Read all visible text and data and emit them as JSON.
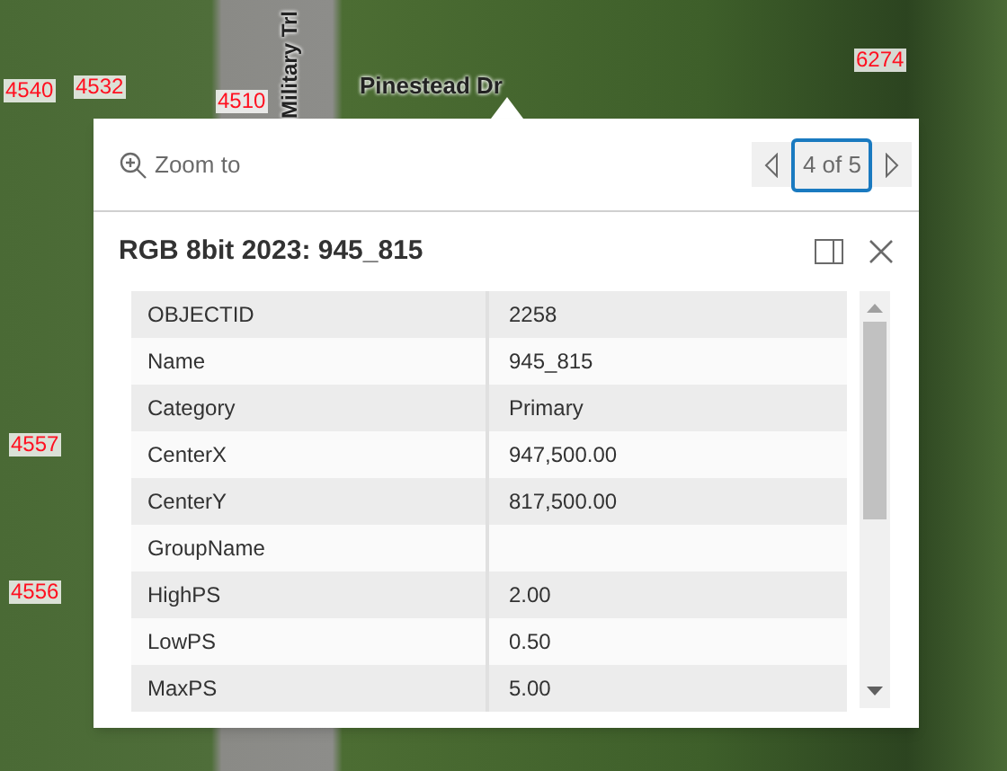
{
  "map_labels": [
    {
      "text": "4540",
      "kind": "parcel"
    },
    {
      "text": "4532",
      "kind": "parcel"
    },
    {
      "text": "4510",
      "kind": "parcel"
    },
    {
      "text": "Military Trl",
      "kind": "road-vertical"
    },
    {
      "text": "Pinestead Dr",
      "kind": "road"
    },
    {
      "text": "6274",
      "kind": "parcel"
    },
    {
      "text": "4557",
      "kind": "parcel"
    },
    {
      "text": "4556",
      "kind": "parcel"
    }
  ],
  "popup": {
    "zoom_to": "Zoom to",
    "pager": "4 of 5",
    "title": "RGB 8bit 2023: 945_815",
    "rows": [
      {
        "field": "OBJECTID",
        "value": "2258"
      },
      {
        "field": "Name",
        "value": "945_815"
      },
      {
        "field": "Category",
        "value": "Primary"
      },
      {
        "field": "CenterX",
        "value": "947,500.00"
      },
      {
        "field": "CenterY",
        "value": "817,500.00"
      },
      {
        "field": "GroupName"
      },
      {
        "field": "HighPS",
        "value": "2.00"
      },
      {
        "field": "LowPS",
        "value": "0.50"
      },
      {
        "field": "MaxPS",
        "value": "5.00"
      }
    ]
  }
}
